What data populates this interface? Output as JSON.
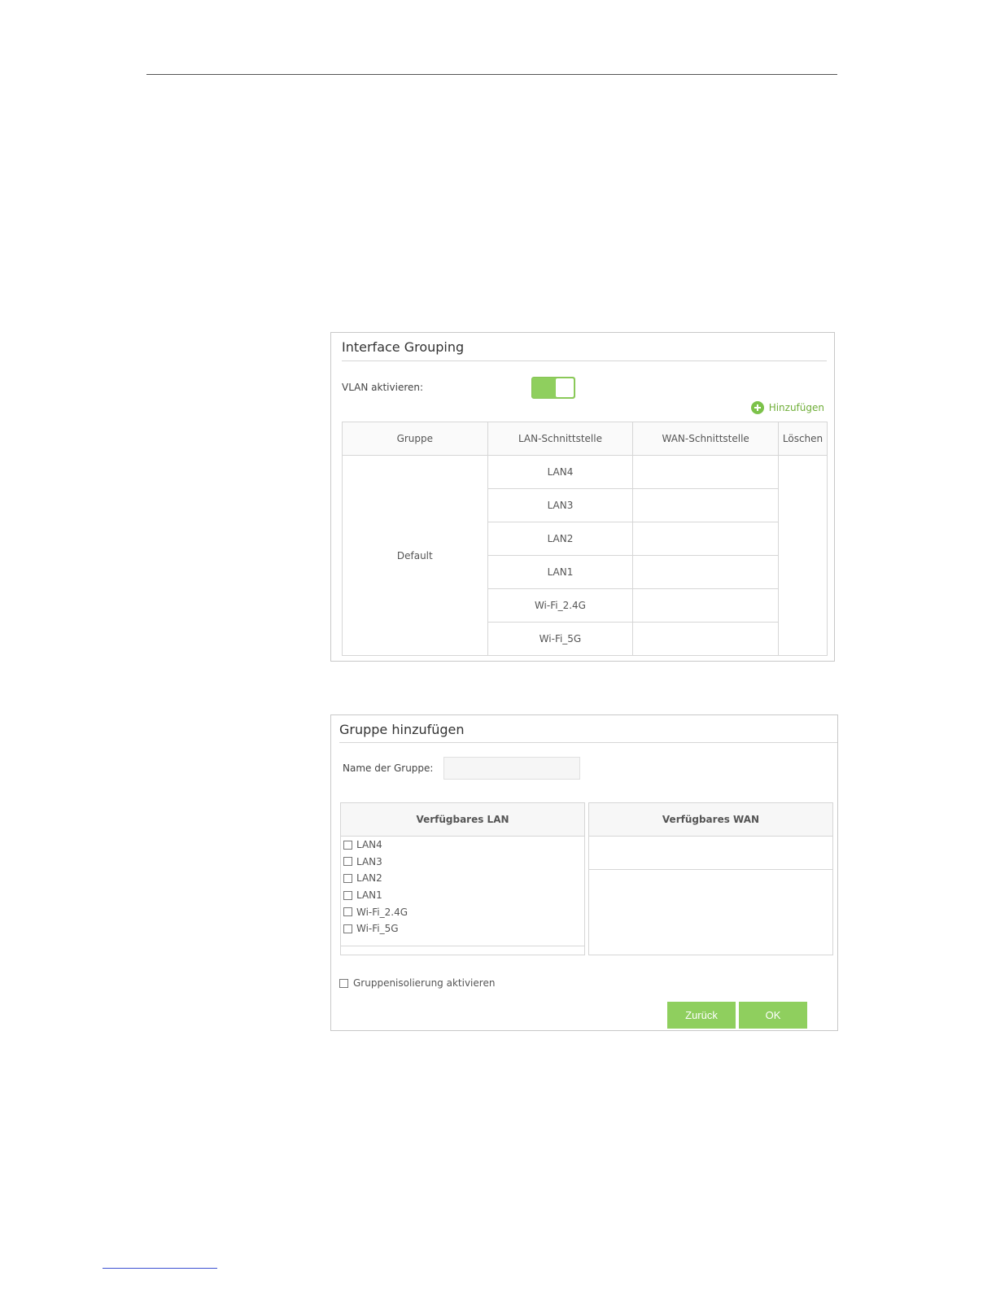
{
  "interface_grouping": {
    "title": "Interface Grouping",
    "vlan_label": "VLAN aktivieren:",
    "vlan_enabled": true,
    "add_label": "Hinzufügen",
    "table": {
      "headers": [
        "Gruppe",
        "LAN-Schnittstelle",
        "WAN-Schnittstelle",
        "Löschen"
      ],
      "group": "Default",
      "lan_interfaces": [
        "LAN4",
        "LAN3",
        "LAN2",
        "LAN1",
        "Wi-Fi_2.4G",
        "Wi-Fi_5G"
      ]
    }
  },
  "add_group": {
    "title": "Gruppe hinzufügen",
    "name_label": "Name der Gruppe:",
    "name_value": "",
    "available_lan_header": "Verfügbares LAN",
    "available_wan_header": "Verfügbares WAN",
    "lan_options": [
      "LAN4",
      "LAN3",
      "LAN2",
      "LAN1",
      "Wi-Fi_2.4G",
      "Wi-Fi_5G"
    ],
    "isolation_label": "Gruppenisolierung aktivieren",
    "back_button": "Zurück",
    "ok_button": "OK"
  },
  "colors": {
    "accent": "#8fcf5e",
    "link": "#6fae38",
    "border": "#d6d6d6"
  },
  "icons": {
    "add": "plus-circle-icon"
  }
}
